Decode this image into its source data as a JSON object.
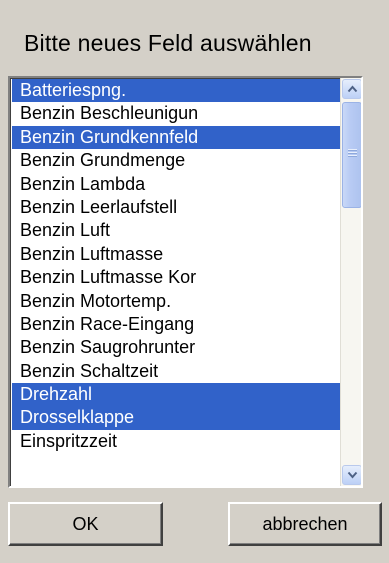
{
  "dialog": {
    "title": "Bitte neues Feld auswählen"
  },
  "list": {
    "items": [
      {
        "label": "Batteriespng.",
        "selected": true
      },
      {
        "label": "Benzin Beschleunigun",
        "selected": false
      },
      {
        "label": "Benzin Grundkennfeld",
        "selected": true
      },
      {
        "label": "Benzin Grundmenge",
        "selected": false
      },
      {
        "label": "Benzin Lambda",
        "selected": false
      },
      {
        "label": "Benzin Leerlaufstell",
        "selected": false
      },
      {
        "label": "Benzin Luft",
        "selected": false
      },
      {
        "label": "Benzin Luftmasse",
        "selected": false
      },
      {
        "label": "Benzin Luftmasse Kor",
        "selected": false
      },
      {
        "label": "Benzin Motortemp.",
        "selected": false
      },
      {
        "label": "Benzin Race-Eingang",
        "selected": false
      },
      {
        "label": "Benzin Saugrohrunter",
        "selected": false
      },
      {
        "label": "Benzin Schaltzeit",
        "selected": false
      },
      {
        "label": "Drehzahl",
        "selected": true
      },
      {
        "label": "Drosselklappe",
        "selected": true
      },
      {
        "label": "Einspritzzeit",
        "selected": false
      }
    ]
  },
  "buttons": {
    "ok_label": "OK",
    "cancel_label": "abbrechen"
  },
  "colors": {
    "dialog_bg": "#d4d0c8",
    "selection_bg": "#3162c9",
    "selection_text": "#ffffff",
    "scrollbar_thumb": "#b8cbf4"
  }
}
